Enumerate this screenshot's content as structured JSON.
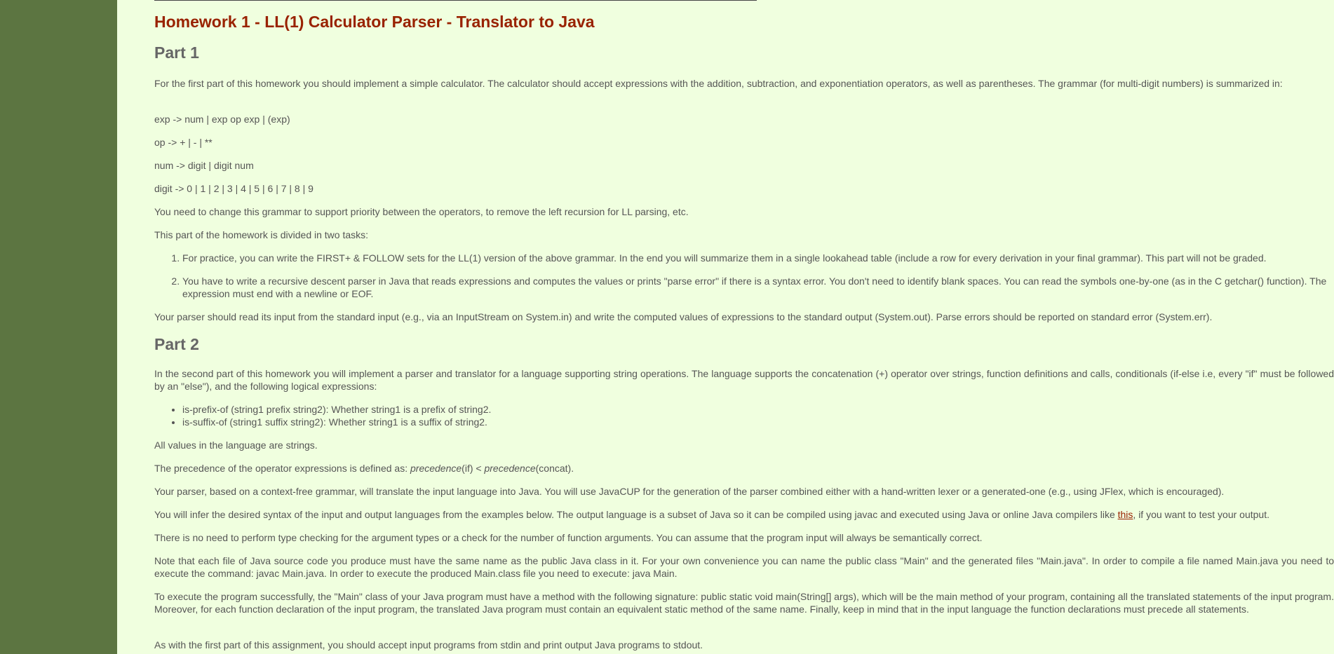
{
  "title": "Homework 1 - LL(1) Calculator Parser - Translator to Java",
  "part1": {
    "heading": "Part 1",
    "intro": "For the first part of this homework you should implement a simple calculator. The calculator should accept expressions with the addition, subtraction, and exponentiation operators, as well as parentheses. The grammar (for multi-digit numbers) is summarized in:",
    "grammar": [
      "exp -> num | exp op exp | (exp)",
      "op -> + | - | **",
      "num -> digit | digit num",
      "digit -> 0 | 1 | 2 | 3 | 4 | 5 | 6 | 7 | 8 | 9"
    ],
    "change_note": "You need to change this grammar to support priority between the operators, to remove the left recursion for LL parsing, etc.",
    "tasks_intro": "This part of the homework is divided in two tasks:",
    "tasks": [
      "For practice, you can write the FIRST+ & FOLLOW sets for the LL(1) version of the above grammar. In the end you will summarize them in a single lookahead table (include a row for every derivation in your final grammar). This part will not be graded.",
      "You have to write a recursive descent parser in Java that reads expressions and computes the values or prints \"parse error\" if there is a syntax error. You don't need to identify blank spaces. You can read the symbols one-by-one (as in the C getchar() function). The expression must end with a newline or EOF."
    ],
    "io_note": "Your parser should read its input from the standard input (e.g., via an InputStream on System.in) and write the computed values of expressions to the standard output (System.out). Parse errors should be reported on standard error (System.err)."
  },
  "part2": {
    "heading": "Part 2",
    "intro": "In the second part of this homework you will implement a parser and translator for a language supporting string operations. The language supports the concatenation (+) operator over strings, function definitions and calls, conditionals (if-else i.e, every \"if\" must be followed by an \"else\"), and the following logical expressions:",
    "logical": [
      "is-prefix-of (string1 prefix string2): Whether string1 is a prefix of string2.",
      "is-suffix-of (string1 suffix string2): Whether string1 is a suffix of string2."
    ],
    "all_strings": "All values in the language are strings.",
    "precedence_prefix": "The precedence of the operator expressions is defined as: ",
    "precedence_word1": "precedence",
    "precedence_mid": "(if) < ",
    "precedence_word2": "precedence",
    "precedence_end": "(concat).",
    "parser_note": "Your parser, based on a context-free grammar, will translate the input language into Java. You will use JavaCUP for the generation of the parser combined either with a hand-written lexer or a generated-one (e.g., using JFlex, which is encouraged).",
    "infer_before": "You will infer the desired syntax of the input and output languages from the examples below. The output language is a subset of Java so it can be compiled using javac and executed using Java or online Java compilers like ",
    "infer_link": "this",
    "infer_after": ", if you want to test your output.",
    "type_note": "There is no need to perform type checking for the argument types or a check for the number of function arguments. You can assume that the program input will always be semantically correct.",
    "file_note": "Note that each file of Java source code you produce must have the same name as the public Java class in it. For your own convenience you can name the public class \"Main\" and the generated files \"Main.java\". In order to compile a file named Main.java you need to execute the command: javac Main.java. In order to execute the produced Main.class file you need to execute: java Main.",
    "exec_note": "To execute the program successfully, the \"Main\" class of your Java program must have a method with the following signature: public static void main(String[] args), which will be the main method of your program, containing all the translated statements of the input program. Moreover, for each function declaration of the input program, the translated Java program must contain an equivalent static method of the same name. Finally, keep in mind that in the input language the function declarations must precede all statements.",
    "stdin_note": "As with the first part of this assignment, you should accept input programs from stdin and print output Java programs to stdout."
  }
}
